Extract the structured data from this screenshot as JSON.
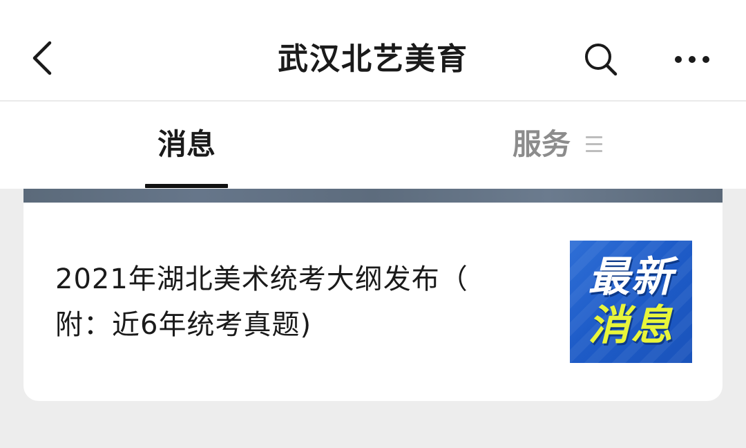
{
  "nav": {
    "title": "武汉北艺美育",
    "back_icon": "chevron-left-icon",
    "search_icon": "search-icon",
    "more_icon": "more-horizontal-icon"
  },
  "tabs": [
    {
      "label": "消息",
      "active": true
    },
    {
      "label": "服务",
      "active": false,
      "icon": "menu-lines-icon"
    }
  ],
  "article": {
    "title_line1": "2021年湖北美术统考大纲发布（",
    "title_line2": "附：近6年统考真题)",
    "thumb_line1": "最新",
    "thumb_line2": "消息"
  },
  "colors": {
    "background": "#ededed",
    "thumb_blue": "#1e5cc8",
    "thumb_yellow": "#e8f53a",
    "inactive_tab": "#8c8c8c"
  }
}
